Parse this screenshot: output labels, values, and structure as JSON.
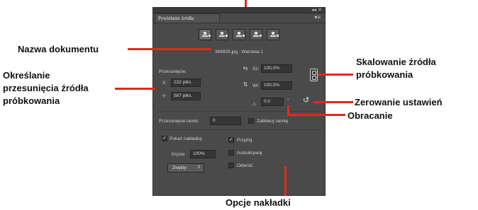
{
  "panel": {
    "title": "Powielanie źródła",
    "menu_glyph": "▾≡",
    "window_controls": "◂◂  ✕",
    "source_buttons": [
      {
        "name": "source-1",
        "active": true
      },
      {
        "name": "source-2",
        "active": false
      },
      {
        "name": "source-3",
        "active": false
      },
      {
        "name": "source-4",
        "active": false
      },
      {
        "name": "source-5",
        "active": false
      }
    ],
    "document_name": "369925.jpg : Warstwa 1",
    "offset": {
      "label": "Przesunięcie:",
      "x_label": "X:",
      "x_value": "232 piks.",
      "y_label": "Y:",
      "y_value": "587 piks."
    },
    "scale": {
      "w_label": "Sz:",
      "w_value": "100,0%",
      "h_label": "Wi:",
      "h_value": "100,0%"
    },
    "rotation": {
      "angle_glyph": "△",
      "value": "0,0",
      "unit": "°",
      "reset_glyph": "↺"
    },
    "frame_offset": {
      "label": "Przesunięcie ramki:",
      "value": "0",
      "lock_label": "Zablokuj ramkę",
      "lock_checked": false
    },
    "overlay": {
      "show_label": "Pokaż nakładkę",
      "show_checked": true,
      "opacity_label": "Krycie:",
      "opacity_value": "100%",
      "blend_mode": "Zwykły",
      "clip_label": "Przytnij",
      "clip_checked": true,
      "autohide_label": "Autoukrywaj",
      "autohide_checked": false,
      "invert_label": "Odwróć",
      "invert_checked": false
    }
  },
  "callouts": {
    "document_name": "Nazwa dokumentu",
    "offset_line1": "Określanie",
    "offset_line2": "przesunięcia źródła",
    "offset_line3": "próbkowania",
    "scale_line1": "Skalowanie źródła",
    "scale_line2": "próbkowania",
    "reset": "Zerowanie ustawień",
    "rotate": "Obracanie",
    "overlay_options": "Opcje nakładki"
  },
  "colors": {
    "panel_bg": "#4a4a4a",
    "field_bg": "#353535",
    "callout_line": "#e02a1e",
    "callout_text": "#111111"
  }
}
